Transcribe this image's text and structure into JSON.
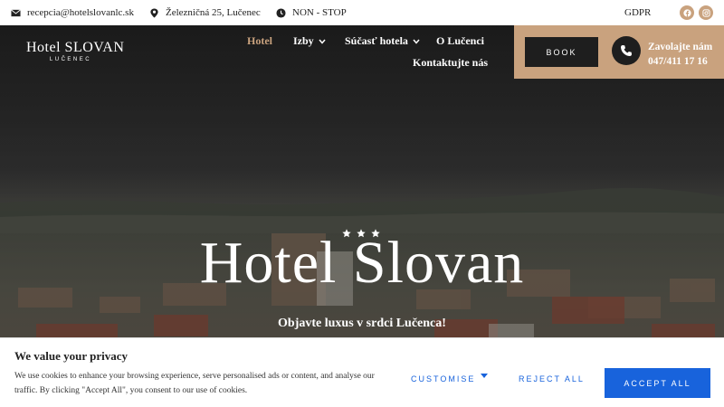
{
  "topbar": {
    "email": "recepcia@hotelslovanlc.sk",
    "address": "Železničná 25, Lučenec",
    "hours": "NON - STOP",
    "gdpr": "GDPR"
  },
  "header": {
    "logo_main": "Hotel SLOVAN",
    "logo_sub": "LUČENEC"
  },
  "nav": {
    "hotel": "Hotel",
    "izby": "Izby",
    "sucast": "Súčasť hotela",
    "lucenci": "O Lučenci",
    "kontakt": "Kontaktujte nás"
  },
  "cta": {
    "book": "BOOK",
    "call_label": "Zavolajte nám",
    "phone": "047/411 17 16"
  },
  "hero": {
    "rating_stars": 3,
    "title": "Hotel Slovan",
    "subtitle": "Objavte luxus v srdci Lučenca!"
  },
  "cookie": {
    "title": "We value your privacy",
    "text": "We use cookies to enhance your browsing experience, serve personalised ads or content, and analyse our traffic. By clicking \"Accept All\", you consent to our use of cookies.",
    "customise": "CUSTOMISE",
    "reject": "REJECT ALL",
    "accept": "ACCEPT ALL"
  },
  "colors": {
    "accent": "#c9a27e",
    "dark": "#1e1e1e",
    "cookie_blue": "#1863dc"
  }
}
